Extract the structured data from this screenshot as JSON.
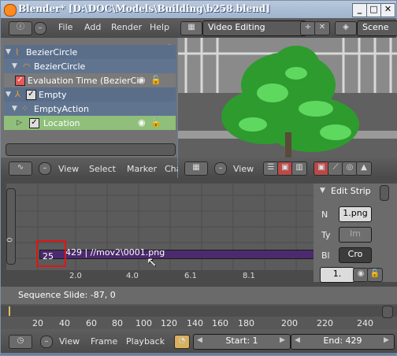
{
  "window": {
    "title": "Blender* [D:\\DOC\\Models\\Building\\b258.blend]",
    "minimize": "_",
    "maximize": "□",
    "close": "✕"
  },
  "info_header": {
    "menu": [
      "File",
      "Add",
      "Render",
      "Help"
    ],
    "screen_layout": "Video Editing",
    "scene": "Scene"
  },
  "channels": {
    "rows": [
      {
        "label": "BezierCircle",
        "indent": 0,
        "expanded": true
      },
      {
        "label": "BezierCircle",
        "indent": 1,
        "expanded": true
      },
      {
        "label": "Evaluation Time (BezierCir",
        "indent": 1,
        "checked": true
      },
      {
        "label": "Empty",
        "indent": 0,
        "expanded": true,
        "checked": true
      },
      {
        "label": "EmptyAction",
        "indent": 1,
        "expanded": true
      },
      {
        "label": "Location",
        "indent": 1,
        "checked": true,
        "selected": true
      }
    ]
  },
  "graph_header": {
    "menu": [
      "View",
      "Select",
      "Marker",
      "Cha"
    ]
  },
  "preview_header": {
    "menu": [
      "View"
    ]
  },
  "sequencer": {
    "y_label": "0",
    "strip_label": "429 | //mov2\\0001.png",
    "current_frame": "25",
    "x_ticks": [
      "2.0",
      "4.0",
      "6.1",
      "8.1"
    ]
  },
  "edit_strip": {
    "title": "Edit Strip",
    "rows": [
      {
        "label": "N",
        "value": "1.png"
      },
      {
        "label": "Ty",
        "value": "Im"
      },
      {
        "label": "Bl",
        "value": "Cro"
      }
    ],
    "channel_value": "1."
  },
  "status": {
    "text": "Sequence Slide: -87, 0"
  },
  "frame_ruler": {
    "ticks": [
      "20",
      "40",
      "60",
      "80",
      "100",
      "120",
      "140",
      "160",
      "180",
      "200",
      "220",
      "240"
    ]
  },
  "timeline_header": {
    "menu": [
      "View",
      "Frame",
      "Playback"
    ],
    "start": "Start: 1",
    "end": "End: 429"
  }
}
